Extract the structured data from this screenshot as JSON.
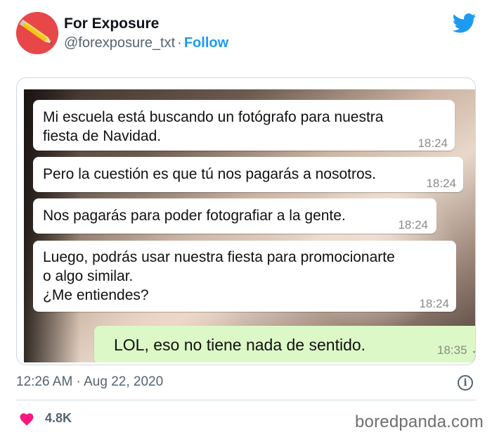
{
  "account": {
    "name": "For Exposure",
    "handle": "@forexposure_txt",
    "separator": "·",
    "follow_label": "Follow",
    "avatar_icon": "pencil-icon",
    "avatar_color": "#e8474a"
  },
  "platform_icon": "twitter-bird-icon",
  "accent_color": "#1d9bf0",
  "messages": [
    {
      "text": "Mi escuela está buscando un fotógrafo para nuestra\nfiesta de Navidad.",
      "time": "18:24",
      "sent": false
    },
    {
      "text": "Pero la cuestión es que tú nos pagarás a nosotros.",
      "time": "18:24",
      "sent": false
    },
    {
      "text": "Nos pagarás para poder fotografiar a la gente.",
      "time": "18:24",
      "sent": false
    },
    {
      "text": "Luego, podrás usar nuestra fiesta para promocionarte\no algo similar.\n¿Me entiendes?",
      "time": "18:24",
      "sent": false
    },
    {
      "text": "LOL, eso no tiene nada de sentido.",
      "time": "18:35",
      "sent": true,
      "read_ticks": "✓✓"
    }
  ],
  "footer": {
    "timestamp": "12:26 AM · Aug 22, 2020",
    "info_icon": "info-icon",
    "info_glyph": "i",
    "like_icon": "heart-icon",
    "likes": "4.8K",
    "like_color": "#f91880"
  },
  "watermark": "boredpanda.com"
}
